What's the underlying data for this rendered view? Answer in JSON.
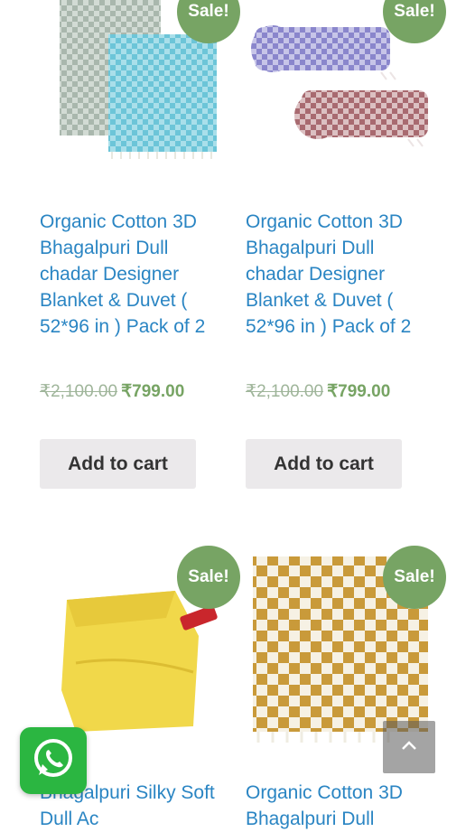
{
  "products": [
    {
      "sale_badge": "Sale!",
      "title": "Organic Cotton 3D Bhagalpuri Dull chadar Designer Blanket & Duvet ( 52*96 in ) Pack of 2",
      "old_price": "₹2,100.00",
      "new_price": "₹799.00",
      "cta": "Add to cart"
    },
    {
      "sale_badge": "Sale!",
      "title": "Organic Cotton 3D Bhagalpuri Dull chadar Designer Blanket & Duvet ( 52*96 in ) Pack of 2",
      "old_price": "₹2,100.00",
      "new_price": "₹799.00",
      "cta": "Add to cart"
    },
    {
      "sale_badge": "Sale!",
      "title": "Bhagalpuri Silky Soft Dull Ac"
    },
    {
      "sale_badge": "Sale!",
      "title": "Organic Cotton 3D Bhagalpuri Dull"
    }
  ],
  "floating": {
    "whatsapp_icon": "whatsapp-icon",
    "scroll_top_icon": "chevron-up-icon"
  },
  "colors": {
    "sale_badge": "#77a464",
    "title_link": "#2a85c3",
    "price": "#77a464",
    "cart_button_bg": "#ebe9eb",
    "whatsapp": "#2bb641"
  }
}
